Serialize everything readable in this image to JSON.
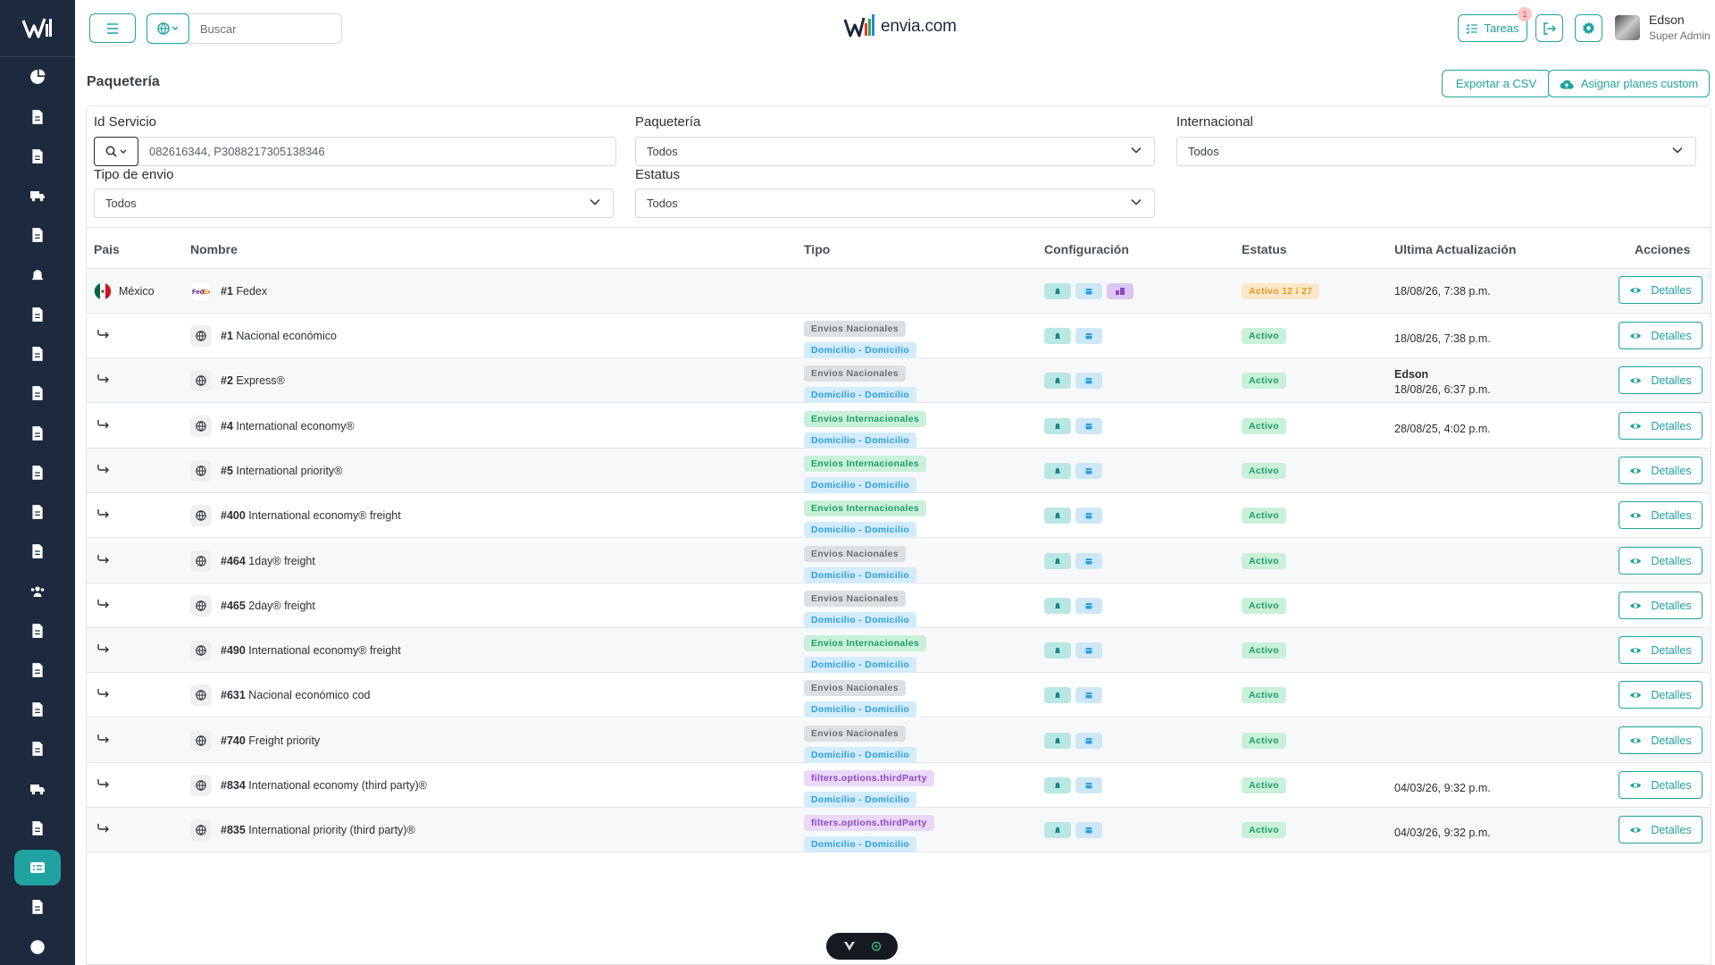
{
  "brand": {
    "name": "envia.com"
  },
  "search": {
    "placeholder": "Buscar"
  },
  "topbar": {
    "tareas_label": "Tareas",
    "tareas_badge": "1",
    "user_name": "Edson",
    "user_role": "Super Admin"
  },
  "page": {
    "title": "Paquetería",
    "export_label": "Exportar a CSV",
    "plans_label": "Asignar planes custom"
  },
  "filters": {
    "id_servicio_label": "Id Servicio",
    "id_servicio_value": "082616344, P3088217305138346",
    "paqueteria_label": "Paquetería",
    "paqueteria_value": "Todos",
    "internacional_label": "Internacional",
    "internacional_value": "Todos",
    "tipo_envio_label": "Tipo de envio",
    "tipo_envio_value": "Todos",
    "estatus_label": "Estatus",
    "estatus_value": "Todos"
  },
  "table": {
    "headers": {
      "pais": "Pais",
      "nombre": "Nombre",
      "tipo": "Tipo",
      "configuracion": "Configuración",
      "estatus": "Estatus",
      "actualizacion": "Ultima Actualización",
      "acciones": "Acciones"
    },
    "action_label": "Detalles",
    "carrier_row": {
      "country": "México",
      "id": "#1",
      "name": "Fedex",
      "status": "Activo 12 / 27",
      "date": "18/08/26, 7:38 p.m."
    },
    "rows": [
      {
        "id": "#1",
        "name": "Nacional económico",
        "type": "Envios Nacionales",
        "route": "Domicilio - Domicilio",
        "status": "Activo",
        "user": "",
        "date": "18/08/26, 7:38 p.m."
      },
      {
        "id": "#2",
        "name": "Express®",
        "type": "Envios Nacionales",
        "route": "Domicilio - Domicilio",
        "status": "Activo",
        "user": "Edson",
        "date": "18/08/26, 6:37 p.m."
      },
      {
        "id": "#4",
        "name": "International economy®",
        "type": "Envios Internacionales",
        "route": "Domicilio - Domicilio",
        "status": "Activo",
        "user": "",
        "date": "28/08/25, 4:02 p.m."
      },
      {
        "id": "#5",
        "name": "International priority®",
        "type": "Envios Internacionales",
        "route": "Domicilio - Domicilio",
        "status": "Activo",
        "user": "",
        "date": ""
      },
      {
        "id": "#400",
        "name": "International economy® freight",
        "type": "Envios Internacionales",
        "route": "Domicilio - Domicilio",
        "status": "Activo",
        "user": "",
        "date": ""
      },
      {
        "id": "#464",
        "name": "1day® freight",
        "type": "Envios Nacionales",
        "route": "Domicilio - Domicilio",
        "status": "Activo",
        "user": "",
        "date": ""
      },
      {
        "id": "#465",
        "name": "2day® freight",
        "type": "Envios Nacionales",
        "route": "Domicilio - Domicilio",
        "status": "Activo",
        "user": "",
        "date": ""
      },
      {
        "id": "#490",
        "name": "International economy® freight",
        "type": "Envios Internacionales",
        "route": "Domicilio - Domicilio",
        "status": "Activo",
        "user": "",
        "date": ""
      },
      {
        "id": "#631",
        "name": "Nacional económico cod",
        "type": "Envios Nacionales",
        "route": "Domicilio - Domicilio",
        "status": "Activo",
        "user": "",
        "date": ""
      },
      {
        "id": "#740",
        "name": "Freight priority",
        "type": "Envios Nacionales",
        "route": "Domicilio - Domicilio",
        "status": "Activo",
        "user": "",
        "date": ""
      },
      {
        "id": "#834",
        "name": "International economy (third party)®",
        "type": "filters.options.thirdParty",
        "route": "Domicilio - Domicilio",
        "status": "Activo",
        "user": "",
        "date": "04/03/26, 9:32 p.m."
      },
      {
        "id": "#835",
        "name": "International priority (third party)®",
        "type": "filters.options.thirdParty",
        "route": "Domicilio - Domicilio",
        "status": "Activo",
        "user": "",
        "date": "04/03/26, 9:32 p.m."
      }
    ]
  },
  "colors": {
    "accent": "#20a3a0",
    "sidebar_bg": "#1d2a3d",
    "status_green": "#1e9f6a",
    "status_warn": "#e39a27"
  }
}
